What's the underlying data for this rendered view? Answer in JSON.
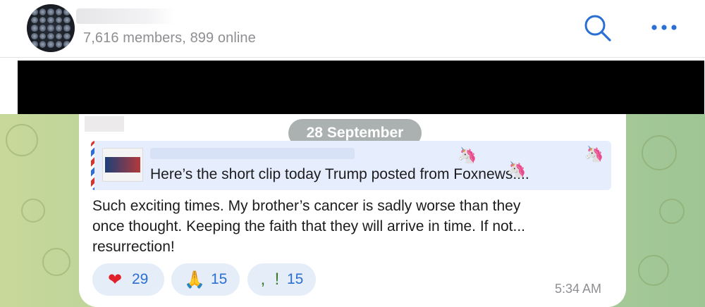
{
  "header": {
    "subtitle": "7,616 members, 899 online",
    "icons": {
      "search": "search-icon",
      "more": "more-icon"
    },
    "accent_color": "#2a6fd4"
  },
  "chat": {
    "date_label": "28 September",
    "quote": {
      "text": "Here’s the short clip today Trump posted from Foxnews...."
    },
    "message": {
      "line1": "Such exciting times.  My brother’s cancer is sadly worse than they",
      "line2": "once thought.  Keeping the faith that they will arrive in time.  If not...",
      "line3": "resurrection!"
    },
    "reactions": [
      {
        "emoji": "heart",
        "count": "29"
      },
      {
        "emoji": "praying-hands",
        "count": "15"
      },
      {
        "emoji": "unknown",
        "count": "15"
      }
    ],
    "timestamp": "5:34 AM"
  }
}
